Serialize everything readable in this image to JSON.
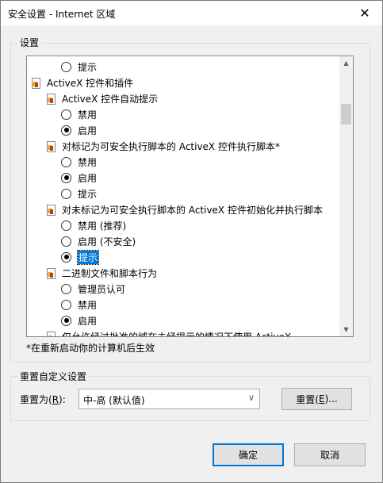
{
  "window": {
    "title": "安全设置 - Internet 区域",
    "close_glyph": "✕"
  },
  "settings": {
    "label": "设置",
    "items": [
      {
        "kind": "radio",
        "level": 2,
        "text": "提示",
        "checked": false
      },
      {
        "kind": "group",
        "level": 0,
        "text": "ActiveX 控件和插件"
      },
      {
        "kind": "group",
        "level": 1,
        "text": "ActiveX 控件自动提示"
      },
      {
        "kind": "radio",
        "level": 2,
        "text": "禁用",
        "checked": false
      },
      {
        "kind": "radio",
        "level": 2,
        "text": "启用",
        "checked": true
      },
      {
        "kind": "group",
        "level": 1,
        "text": "对标记为可安全执行脚本的 ActiveX 控件执行脚本*"
      },
      {
        "kind": "radio",
        "level": 2,
        "text": "禁用",
        "checked": false
      },
      {
        "kind": "radio",
        "level": 2,
        "text": "启用",
        "checked": true
      },
      {
        "kind": "radio",
        "level": 2,
        "text": "提示",
        "checked": false
      },
      {
        "kind": "group",
        "level": 1,
        "text": "对未标记为可安全执行脚本的 ActiveX 控件初始化并执行脚本"
      },
      {
        "kind": "radio",
        "level": 2,
        "text": "禁用 (推荐)",
        "checked": false
      },
      {
        "kind": "radio",
        "level": 2,
        "text": "启用 (不安全)",
        "checked": false
      },
      {
        "kind": "radio",
        "level": 2,
        "text": "提示",
        "checked": true,
        "selected": true
      },
      {
        "kind": "group",
        "level": 1,
        "text": "二进制文件和脚本行为"
      },
      {
        "kind": "radio",
        "level": 2,
        "text": "管理员认可",
        "checked": false
      },
      {
        "kind": "radio",
        "level": 2,
        "text": "禁用",
        "checked": false
      },
      {
        "kind": "radio",
        "level": 2,
        "text": "启用",
        "checked": true
      },
      {
        "kind": "group",
        "level": 1,
        "text": "仅允许经过批准的域在未经提示的情况下使用 ActiveX"
      }
    ],
    "footnote": "*在重新启动你的计算机后生效"
  },
  "reset": {
    "group_label": "重置自定义设置",
    "to_label_prefix": "重置为(",
    "to_label_key": "R",
    "to_label_suffix": "):",
    "selected_value": "中-高 (默认值)",
    "button_prefix": "重置(",
    "button_key": "E",
    "button_suffix": ")..."
  },
  "buttons": {
    "ok": "确定",
    "cancel": "取消"
  },
  "colors": {
    "selection": "#0078d7",
    "focus_border": "#0078d7",
    "dialog_bg": "#f0f0f0"
  }
}
